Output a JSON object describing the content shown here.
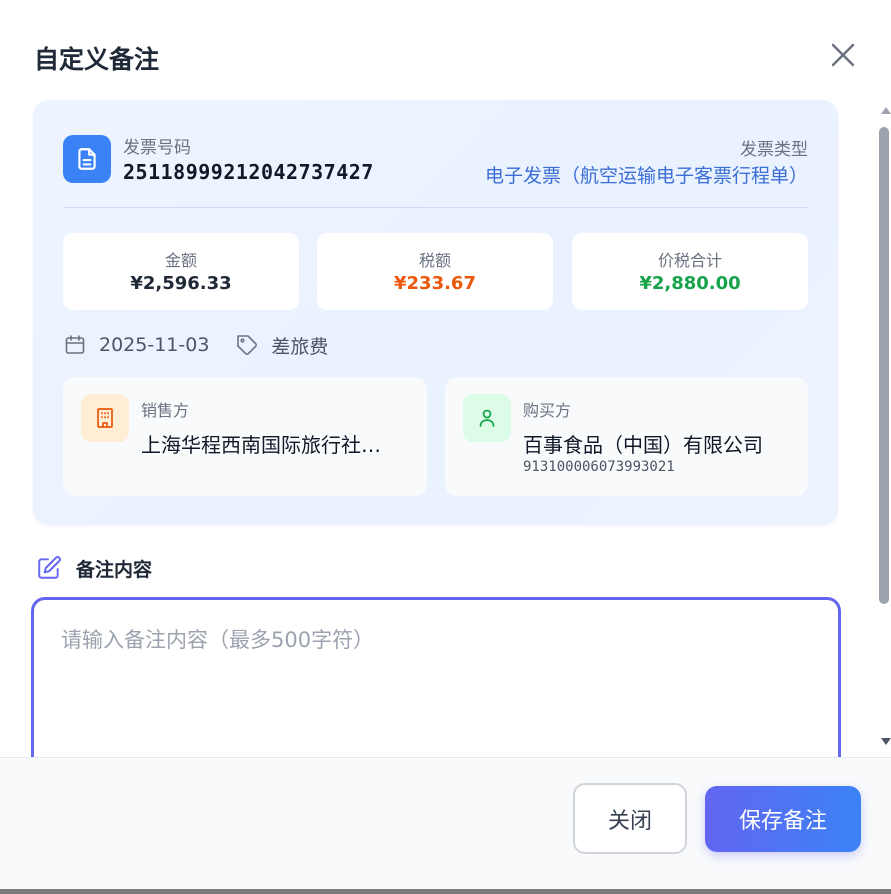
{
  "dialog": {
    "title": "自定义备注"
  },
  "invoice": {
    "number_label": "发票号码",
    "number": "25118999212042737427",
    "type_label": "发票类型",
    "type": "电子发票（航空运输电子客票行程单）"
  },
  "amounts": [
    {
      "label": "金额",
      "value": "¥2,596.33",
      "color": "#1f2937"
    },
    {
      "label": "税额",
      "value": "¥233.67",
      "color": "#ea580c"
    },
    {
      "label": "价税合计",
      "value": "¥2,880.00",
      "color": "#16a34a"
    }
  ],
  "meta": {
    "date": "2025-11-03",
    "category": "差旅费"
  },
  "seller": {
    "label": "销售方",
    "name": "上海华程西南国际旅行社有限公司"
  },
  "buyer": {
    "label": "购买方",
    "name": "百事食品（中国）有限公司",
    "tax_id": "913100006073993021"
  },
  "remark": {
    "label": "备注内容",
    "placeholder": "请输入备注内容（最多500字符）",
    "value": ""
  },
  "footer": {
    "close_label": "关闭",
    "save_label": "保存备注"
  },
  "colors": {
    "accent": "#6366f1",
    "primary": "#3b82f6"
  },
  "icons": {
    "close": "close-icon",
    "invoice": "document-icon",
    "date": "calendar-icon",
    "category": "tag-icon",
    "seller": "building-icon",
    "buyer": "user-icon",
    "remark": "edit-icon"
  }
}
